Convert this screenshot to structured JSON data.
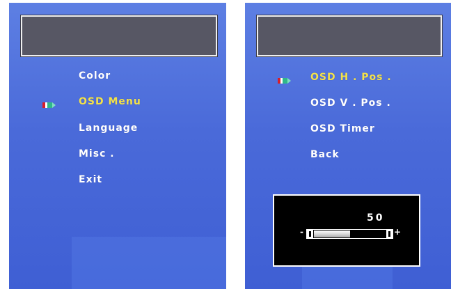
{
  "left_menu": {
    "items": [
      {
        "label": "Color",
        "selected": false
      },
      {
        "label": "OSD  Menu",
        "selected": true
      },
      {
        "label": "Language",
        "selected": false
      },
      {
        "label": "Misc .",
        "selected": false
      },
      {
        "label": "Exit",
        "selected": false
      }
    ]
  },
  "right_menu": {
    "items": [
      {
        "label": "OSD  H . Pos .",
        "selected": true
      },
      {
        "label": "OSD  V . Pos .",
        "selected": false
      },
      {
        "label": "OSD  Timer",
        "selected": false
      },
      {
        "label": "Back",
        "selected": false
      }
    ]
  },
  "adjust": {
    "value": "50",
    "minus": "-",
    "plus": "+",
    "level": 0.5
  },
  "colors": {
    "background": "#4a6ad9",
    "selected_text": "#f3e24a",
    "normal_text": "#ffffff",
    "title_box": "#575764"
  },
  "icons": {
    "pointer": "pencil-pointer-icon"
  }
}
